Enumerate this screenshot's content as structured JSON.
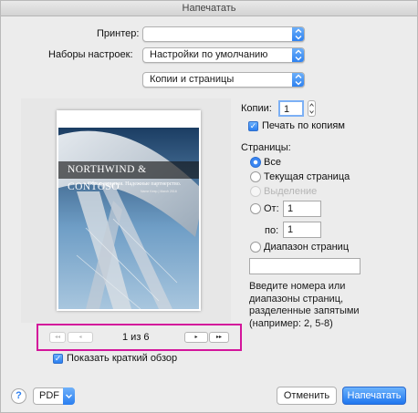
{
  "window": {
    "title": "Напечатать"
  },
  "printer": {
    "label": "Принтер:",
    "value": ""
  },
  "presets": {
    "label": "Наборы настроек:",
    "value": "Настройки по умолчанию"
  },
  "section": {
    "value": "Копии и страницы"
  },
  "preview": {
    "doc_title": "NORTHWIND & CONTOSO",
    "doc_subtitle": "Обзор видения. Надежные партнерство.",
    "doc_small": "Name Keep | March 2016",
    "page_indicator": "1 из 6",
    "nav": {
      "first": "◂◂",
      "prev": "◂",
      "next": "▸",
      "last": "▸▸"
    }
  },
  "show_preview": {
    "label": "Показать краткий обзор",
    "checked": true
  },
  "copies": {
    "label": "Копии:",
    "value": "1"
  },
  "collate": {
    "label": "Печать по копиям",
    "checked": true
  },
  "pages": {
    "label": "Страницы:",
    "options": {
      "all": "Все",
      "current": "Текущая страница",
      "selection": "Выделение",
      "from": "От:",
      "range": "Диапазон страниц"
    },
    "selected": "all",
    "from_value": "1",
    "to_label": "по:",
    "to_value": "1",
    "range_value": "",
    "hint": "Введите номера или диапазоны страниц, разделенные запятыми (например: 2, 5-8)"
  },
  "footer": {
    "help": "?",
    "pdf": "PDF",
    "cancel": "Отменить",
    "print": "Напечатать"
  },
  "colors": {
    "accent": "#2a7ef0",
    "highlight": "#d3159b"
  }
}
